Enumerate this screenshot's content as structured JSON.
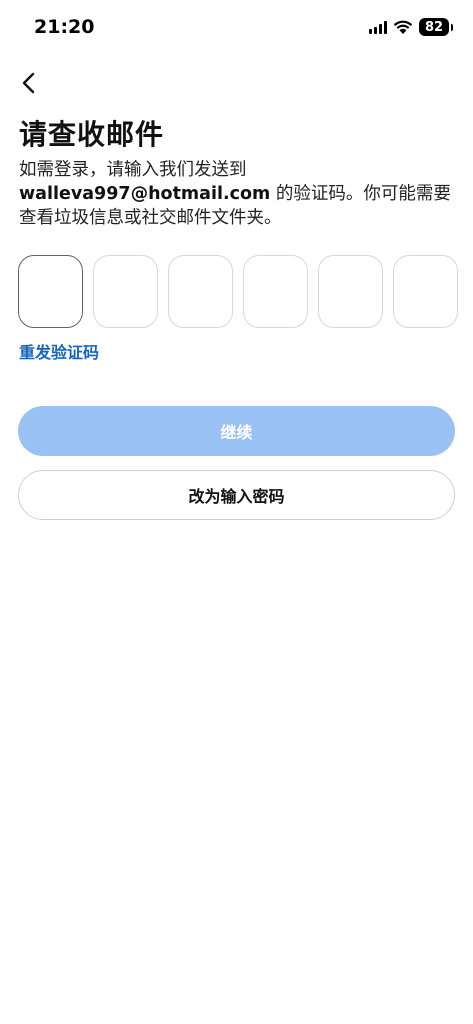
{
  "status_bar": {
    "time": "21:20",
    "battery": "82",
    "icons": [
      "signal-icon",
      "wifi-icon",
      "battery-icon"
    ]
  },
  "header": {
    "back_icon": "chevron-left-icon",
    "title": "请查收邮件"
  },
  "message": {
    "line1": "如需登录，请输入我们发送到",
    "email": "walleva997@hotmail.com",
    "line2": " 的验证码。你可能需要查看垃圾信息或社交邮件文件夹。"
  },
  "code_input": {
    "box_count": 6,
    "values": [
      "",
      "",
      "",
      "",
      "",
      ""
    ],
    "active_index": 0
  },
  "actions": {
    "resend_label": "重发验证码",
    "continue_label": "继续",
    "password_label": "改为输入密码"
  },
  "colors": {
    "accent": "#1565c0",
    "continue_disabled": "#99c1f3"
  }
}
